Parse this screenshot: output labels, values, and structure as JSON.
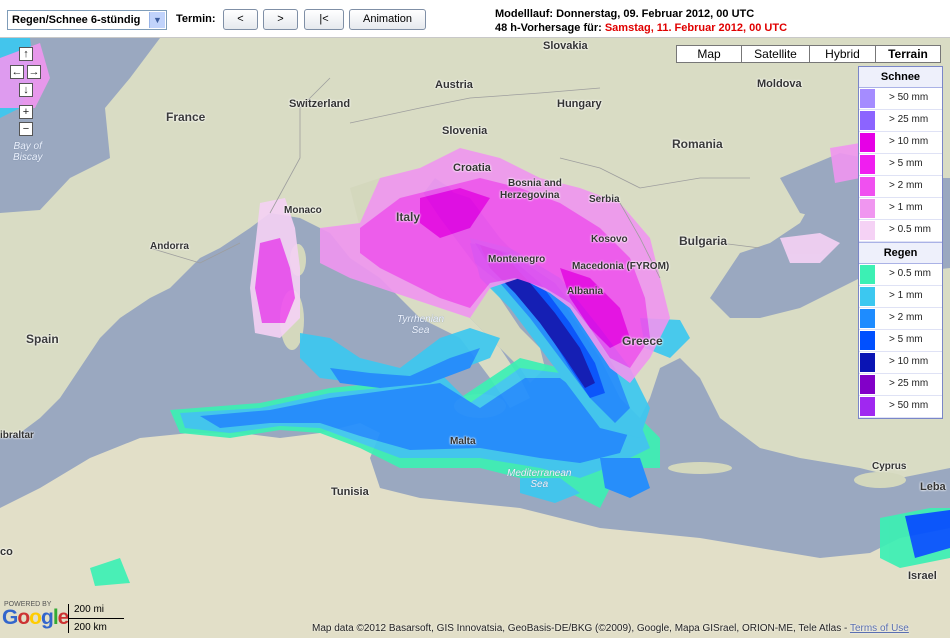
{
  "toolbar": {
    "product_select": "Regen/Schnee 6-stündig",
    "termin_label": "Termin:",
    "prev_label": "<",
    "next_label": ">",
    "first_label": "|<",
    "animation_label": "Animation"
  },
  "run_info": {
    "model_run": "Modelllauf: Donnerstag, 09. Februar 2012, 00 UTC",
    "forecast_prefix": "48 h-Vorhersage für:",
    "forecast_date": "Samstag, 11. Februar 2012, 00 UTC"
  },
  "map_types": [
    "Map",
    "Satellite",
    "Hybrid",
    "Terrain"
  ],
  "map_type_active": "Terrain",
  "nav": {
    "up": "↑",
    "left": "←",
    "right": "→",
    "down": "↓",
    "zoom_in": "+",
    "zoom_out": "−"
  },
  "legend": {
    "snow_title": "Schnee",
    "snow": [
      {
        "label": "> 50 mm",
        "color": "#a58cff"
      },
      {
        "label": "> 25 mm",
        "color": "#8c64ff"
      },
      {
        "label": "> 10 mm",
        "color": "#e600e6"
      },
      {
        "label": "> 5 mm",
        "color": "#f01ef0"
      },
      {
        "label": "> 2 mm",
        "color": "#f050f0"
      },
      {
        "label": "> 1 mm",
        "color": "#f096f0"
      },
      {
        "label": "> 0.5 mm",
        "color": "#f5d2f5"
      }
    ],
    "rain_title": "Regen",
    "rain": [
      {
        "label": "> 0.5 mm",
        "color": "#3cf0b4"
      },
      {
        "label": "> 1 mm",
        "color": "#3cc8f0"
      },
      {
        "label": "> 2 mm",
        "color": "#1e8cff"
      },
      {
        "label": "> 5 mm",
        "color": "#0050ff"
      },
      {
        "label": "> 10 mm",
        "color": "#0a14b4"
      },
      {
        "label": "> 25 mm",
        "color": "#8200c8"
      },
      {
        "label": "> 50 mm",
        "color": "#a028f0"
      }
    ]
  },
  "places": {
    "slovakia": "Slovakia",
    "austria": "Austria",
    "hungary": "Hungary",
    "moldova": "Moldova",
    "switzerland": "Switzerland",
    "france": "France",
    "slovenia": "Slovenia",
    "romania": "Romania",
    "croatia": "Croatia",
    "bosnia": "Bosnia and",
    "herzegovina": "Herzegovina",
    "serbia": "Serbia",
    "monaco": "Monaco",
    "italy": "Italy",
    "kosovo": "Kosovo",
    "bulgaria": "Bulgaria",
    "andorra": "Andorra",
    "montenegro": "Montenegro",
    "macedonia": "Macedonia (FYROM)",
    "albania": "Albania",
    "spain": "Spain",
    "greece": "Greece",
    "gibraltar": "ibraltar",
    "malta": "Malta",
    "cyprus": "Cyprus",
    "tunisia": "Tunisia",
    "lebanon": "Leba",
    "israel": "Israel",
    "morocco": "co"
  },
  "seas": {
    "biscay1": "Bay of",
    "biscay2": "Biscay",
    "tyrr1": "Tyrrhenian",
    "tyrr2": "Sea",
    "med1": "Mediterranean",
    "med2": "Sea"
  },
  "footer": {
    "powered": "POWERED BY",
    "google": "Google",
    "scale_mi": "200 mi",
    "scale_km": "200 km",
    "attribution": "Map data ©2012 Basarsoft, GIS Innovatsia, GeoBasis-DE/BKG (©2009), Google, Mapa GISrael, ORION-ME, Tele Atlas -",
    "terms": "Terms of Use"
  }
}
